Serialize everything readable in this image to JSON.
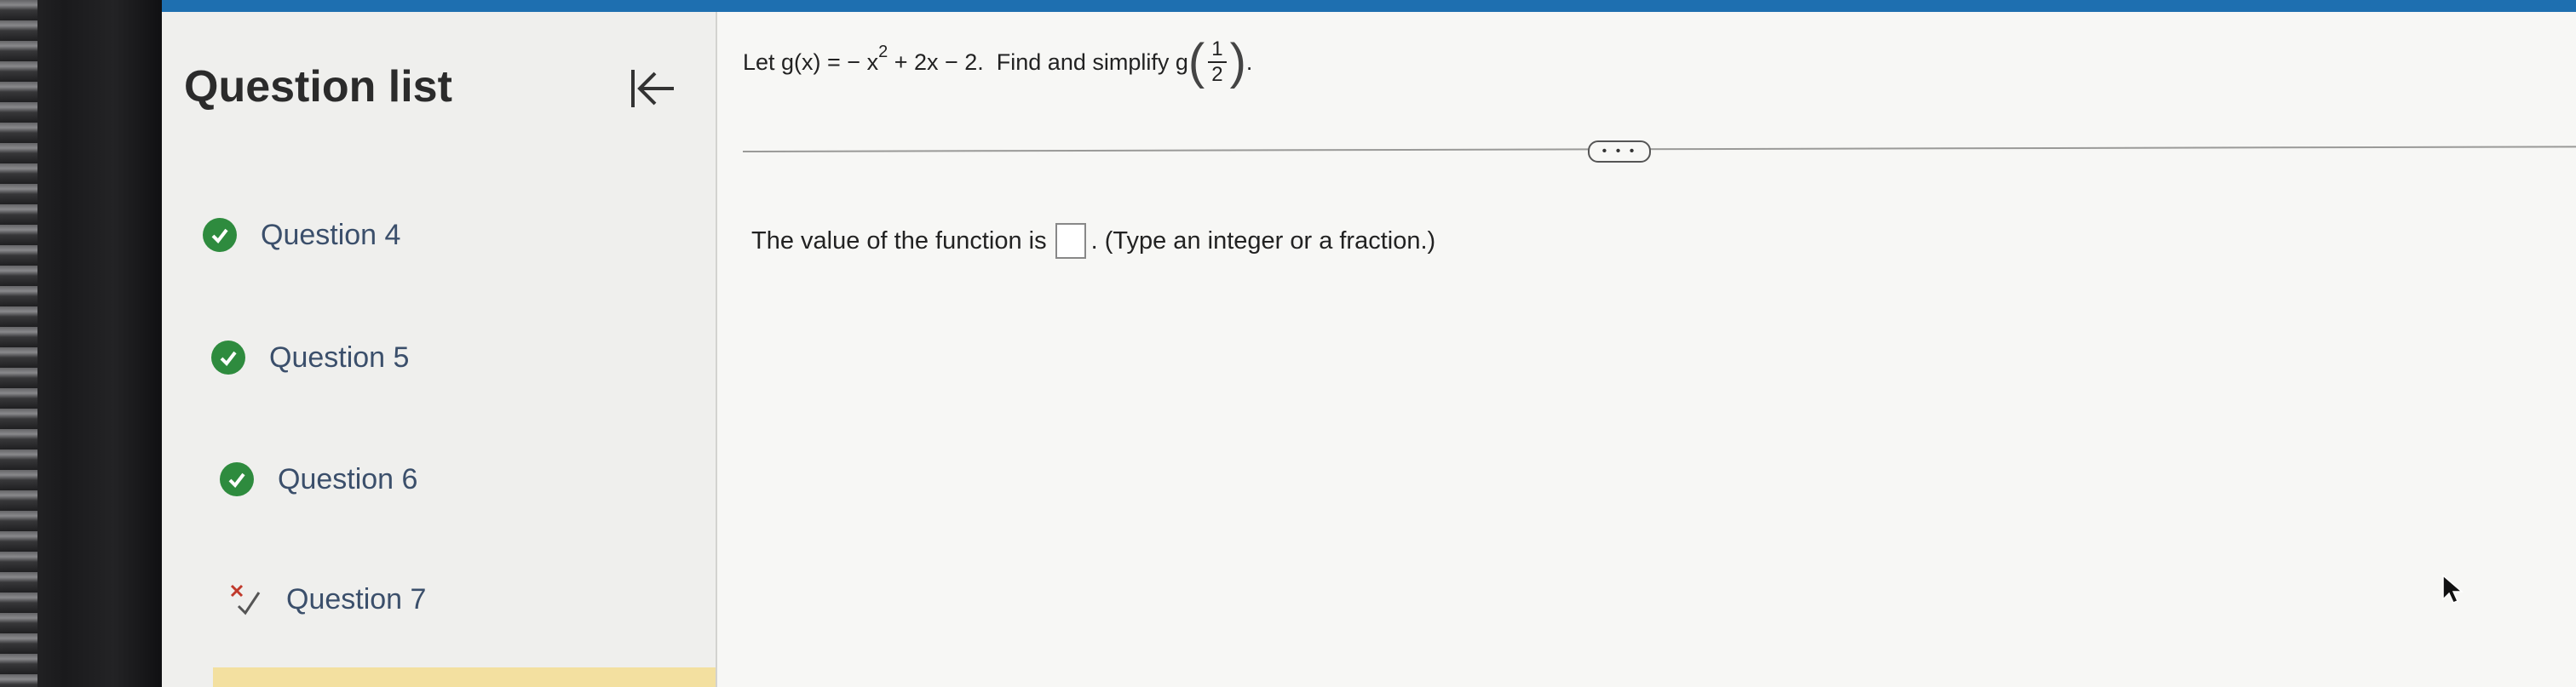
{
  "sidebar": {
    "title": "Question list",
    "items": [
      {
        "label": "Question 4",
        "status": "correct"
      },
      {
        "label": "Question 5",
        "status": "correct"
      },
      {
        "label": "Question 6",
        "status": "correct"
      },
      {
        "label": "Question 7",
        "status": "partial"
      }
    ]
  },
  "question": {
    "intro": "Let g(x) = − x",
    "exponent": "2",
    "rest": " + 2x − 2.  Find and simplify g",
    "frac_num": "1",
    "frac_den": "2",
    "end": "."
  },
  "answer": {
    "prefix": "The value of the function is",
    "suffix": ". (Type an integer or a fraction.)"
  },
  "expand_label": "• • •",
  "colors": {
    "accent": "#1e6fb0",
    "correct": "#2e8b3e",
    "active": "#f3e0a0"
  }
}
